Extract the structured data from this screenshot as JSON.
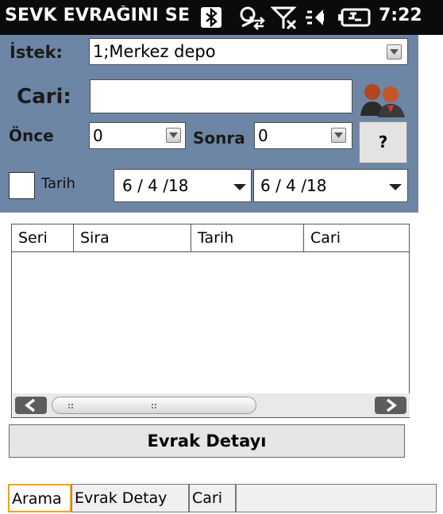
{
  "statusbar": {
    "title": "SEVK EVRAĞINI SEÇ",
    "clock": "7:22",
    "icons": [
      "bluetooth-icon",
      "data-sync-icon",
      "no-signal-icon",
      "speaker-icon",
      "battery-icon"
    ]
  },
  "form": {
    "istek_label": "İstek:",
    "istek_value": "1;Merkez depo",
    "cari_label": "Cari:",
    "cari_value": "",
    "once_label": "Önce",
    "once_value": "0",
    "sonra_label": "Sonra",
    "sonra_value": "0",
    "help_label": "?",
    "tarih_label": "Tarih",
    "tarih_checked": false,
    "date_from": "6 / 4 /18",
    "date_to": "6 / 4 /18"
  },
  "list": {
    "columns": [
      "Seri",
      "Sira",
      "Tarih",
      "Cari"
    ],
    "rows": []
  },
  "detay_button": "Evrak Detayı",
  "tabs": [
    "Arama",
    "Evrak Detay",
    "Cari"
  ],
  "active_tab": "Arama",
  "colors": {
    "panel": "#6e86a5",
    "titlebar": "#0b0b0b",
    "active_tab_border": "#f0a21c"
  }
}
